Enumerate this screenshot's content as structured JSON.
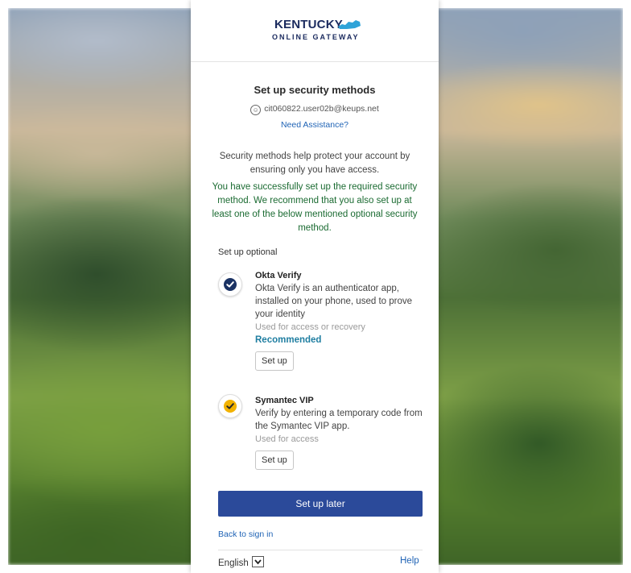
{
  "logo": {
    "title": "KENTUCKY",
    "subtitle": "ONLINE GATEWAY"
  },
  "heading": "Set up security methods",
  "user": {
    "email": "cit060822.user02b@keups.net",
    "assistance_link": "Need Assistance?"
  },
  "description": "Security methods help protect your account by ensuring only you have access.",
  "success_message": "You have successfully set up the required security method. We recommend that you also set up at least one of the below mentioned optional security method.",
  "optional_label": "Set up optional",
  "methods": [
    {
      "title": "Okta Verify",
      "description": "Okta Verify is an authenticator app, installed on your phone, used to prove your identity",
      "usage": "Used for access or recovery",
      "badge": "Recommended",
      "button": "Set up",
      "icon": "okta-verify-icon",
      "icon_color": "#1a3263"
    },
    {
      "title": "Symantec VIP",
      "description": "Verify by entering a temporary code from the Symantec VIP app.",
      "usage": "Used for access",
      "button": "Set up",
      "icon": "symantec-vip-icon",
      "icon_color": "#f2b200"
    }
  ],
  "setup_later": "Set up later",
  "back_to_sign_in": "Back to sign in",
  "language": {
    "selected": "English"
  },
  "help": "Help",
  "colors": {
    "primary_button": "#2b4a9a",
    "link": "#1f63b5",
    "success": "#1b6b32",
    "accent": "#1f7ea1"
  }
}
